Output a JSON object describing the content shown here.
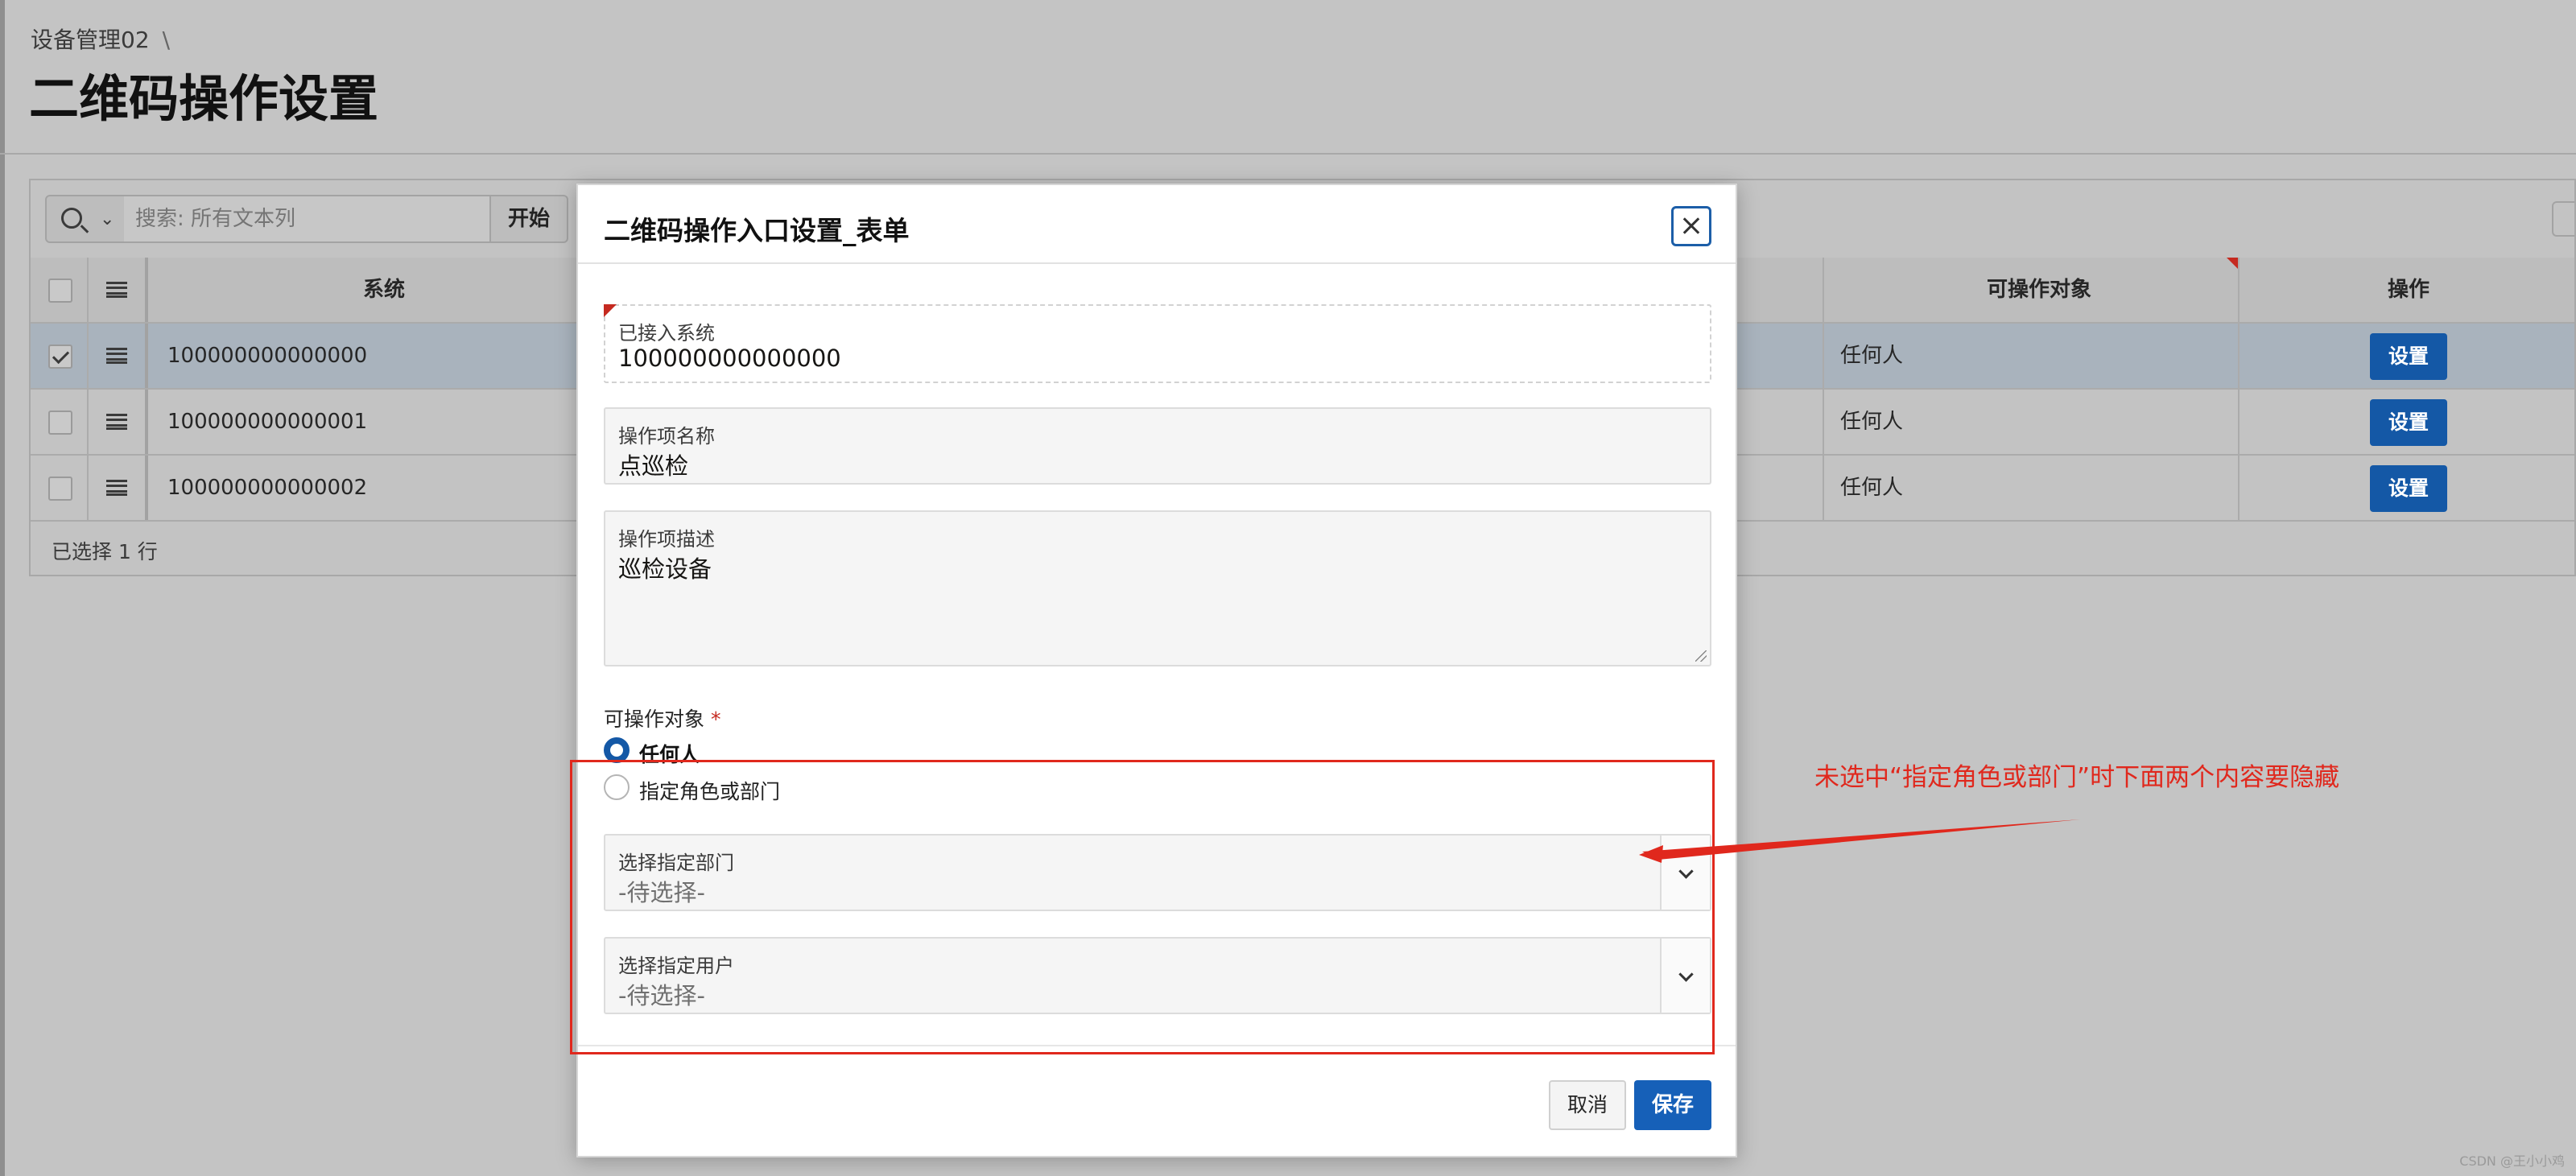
{
  "breadcrumb": {
    "item": "设备管理02",
    "separator": "\\"
  },
  "page_title": "二维码操作设置",
  "toolbar": {
    "search_placeholder": "搜索: 所有文本列",
    "go_label": "开始"
  },
  "grid": {
    "headers": {
      "system": "系统",
      "target": "可操作对象",
      "action": "操作"
    },
    "rows": [
      {
        "system": "100000000000000",
        "target": "任何人",
        "action": "设置",
        "selected": true
      },
      {
        "system": "100000000000001",
        "target": "任何人",
        "action": "设置",
        "selected": false
      },
      {
        "system": "100000000000002",
        "target": "任何人",
        "action": "设置",
        "selected": false
      }
    ],
    "footer": "已选择 1 行"
  },
  "modal": {
    "title": "二维码操作入口设置_表单",
    "fields": {
      "system_label": "已接入系统",
      "system_value": "100000000000000",
      "name_label": "操作项名称",
      "name_value": "点巡检",
      "desc_label": "操作项描述",
      "desc_value": "巡检设备"
    },
    "target_group": {
      "label": "可操作对象",
      "required_mark": "*",
      "options": [
        "任何人",
        "指定角色或部门"
      ],
      "selected": "任何人"
    },
    "selects": {
      "dept_label": "选择指定部门",
      "dept_value": "-待选择-",
      "user_label": "选择指定用户",
      "user_value": "-待选择-"
    },
    "buttons": {
      "cancel": "取消",
      "save": "保存"
    }
  },
  "annotation": {
    "text": "未选中“指定角色或部门”时下面两个内容要隐藏",
    "color": "#e0281d"
  },
  "watermark": "CSDN @王小小鸡",
  "colors": {
    "primary": "#1458a6",
    "required": "#c52a20"
  }
}
